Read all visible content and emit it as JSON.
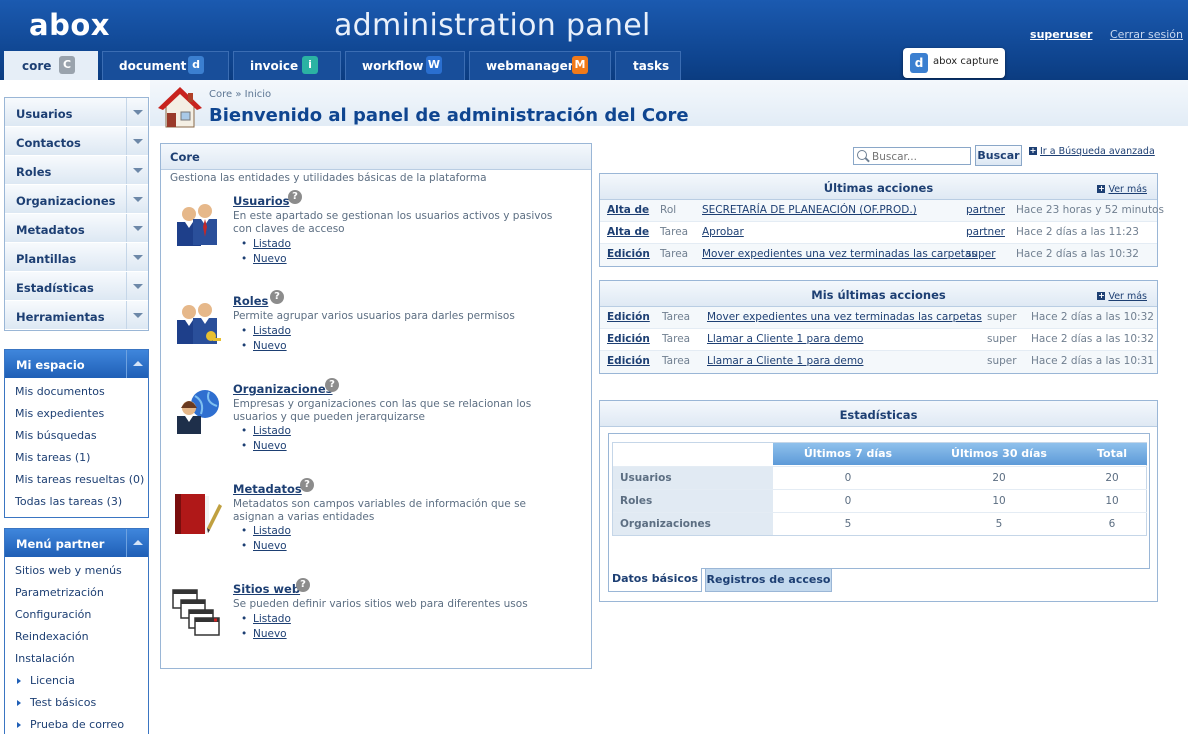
{
  "header": {
    "logo": "abox",
    "title": "administration panel",
    "user": "superuser",
    "logout": "Cerrar sesión",
    "capture_label": "abox capture",
    "capture_icon_glyph": "d"
  },
  "tabs": [
    {
      "label": "core",
      "glyph": "C",
      "color": "#9aa3ad",
      "icon": "core-icon"
    },
    {
      "label": "document",
      "glyph": "d",
      "color": "#3b7fd0",
      "icon": "document-icon"
    },
    {
      "label": "invoice",
      "glyph": "i",
      "color": "#2bb3a3",
      "icon": "invoice-icon"
    },
    {
      "label": "workflow",
      "glyph": "W",
      "color": "#2a6fd0",
      "icon": "workflow-icon"
    },
    {
      "label": "webmanager",
      "glyph": "M",
      "color": "#f07a1a",
      "icon": "webmanager-icon"
    },
    {
      "label": "tasks",
      "glyph": "",
      "color": "",
      "icon": ""
    }
  ],
  "sidebar": {
    "menu": [
      "Usuarios",
      "Contactos",
      "Roles",
      "Organizaciones",
      "Metadatos",
      "Plantillas",
      "Estadísticas",
      "Herramientas"
    ],
    "mi_espacio": {
      "title": "Mi espacio",
      "items": [
        "Mis documentos",
        "Mis expedientes",
        "Mis búsquedas",
        "Mis tareas (1)",
        "Mis tareas resueltas (0)",
        "Todas las tareas (3)"
      ]
    },
    "partner": {
      "title": "Menú partner",
      "items": [
        "Sitios web y menús",
        "Parametrización",
        "Configuración",
        "Reindexación",
        "Instalación"
      ],
      "subitems": [
        "Licencia",
        "Test básicos",
        "Prueba de correo"
      ]
    }
  },
  "breadcrumb": {
    "root": "Core",
    "sep": "»",
    "current": "Inicio"
  },
  "page_title": "Bienvenido al panel de administración del Core",
  "core": {
    "title": "Core",
    "desc": "Gestiona las entidades y utilidades básicas de la plataforma",
    "entities": [
      {
        "name": "Usuarios",
        "desc": "En este apartado se gestionan los usuarios activos y pasivos con claves de acceso",
        "links": [
          "Listado",
          "Nuevo"
        ]
      },
      {
        "name": "Roles",
        "desc": "Permite agrupar varios usuarios para darles permisos",
        "links": [
          "Listado",
          "Nuevo"
        ]
      },
      {
        "name": "Organizaciones",
        "desc": "Empresas y organizaciones con las que se relacionan los usuarios y que pueden jerarquizarse",
        "links": [
          "Listado",
          "Nuevo"
        ]
      },
      {
        "name": "Metadatos",
        "desc": "Metadatos son campos variables de información que se asignan a varias entidades",
        "links": [
          "Listado",
          "Nuevo"
        ]
      },
      {
        "name": "Sitios web",
        "desc": "Se pueden definir varios sitios web para diferentes usos",
        "links": [
          "Listado",
          "Nuevo"
        ]
      }
    ]
  },
  "search": {
    "placeholder": "Buscar...",
    "button": "Buscar",
    "advanced": "Ir a Búsqueda avanzada"
  },
  "ultimas": {
    "title": "Últimas acciones",
    "more": "Ver más",
    "rows": [
      [
        "Alta de",
        "Rol",
        "SECRETARÍA DE PLANEACIÓN (OF.PROD.)",
        "partner",
        "Hace 23 horas y 52 minutos"
      ],
      [
        "Alta de",
        "Tarea",
        "Aprobar",
        "partner",
        "Hace 2 días a las 11:23"
      ],
      [
        "Edición",
        "Tarea",
        "Mover expedientes una vez terminadas las carpetas",
        "super",
        "Hace 2 días a las 10:32"
      ]
    ]
  },
  "mis_ultimas": {
    "title": "Mis últimas acciones",
    "more": "Ver más",
    "rows": [
      [
        "Edición",
        "Tarea",
        "Mover expedientes una vez terminadas las carpetas",
        "super",
        "Hace 2 días a las 10:32"
      ],
      [
        "Edición",
        "Tarea",
        "Llamar a Cliente 1 para demo",
        "super",
        "Hace 2 días a las 10:32"
      ],
      [
        "Edición",
        "Tarea",
        "Llamar a Cliente 1 para demo",
        "super",
        "Hace 2 días a las 10:31"
      ]
    ]
  },
  "stats": {
    "title": "Estadísticas",
    "columns": [
      "Últimos 7 días",
      "Últimos 30 días",
      "Total"
    ],
    "rows": [
      {
        "label": "Usuarios",
        "values": [
          "0",
          "20",
          "20"
        ]
      },
      {
        "label": "Roles",
        "values": [
          "0",
          "10",
          "10"
        ]
      },
      {
        "label": "Organizaciones",
        "values": [
          "5",
          "5",
          "6"
        ]
      }
    ],
    "tabs": [
      "Datos básicos",
      "Registros de acceso"
    ]
  }
}
